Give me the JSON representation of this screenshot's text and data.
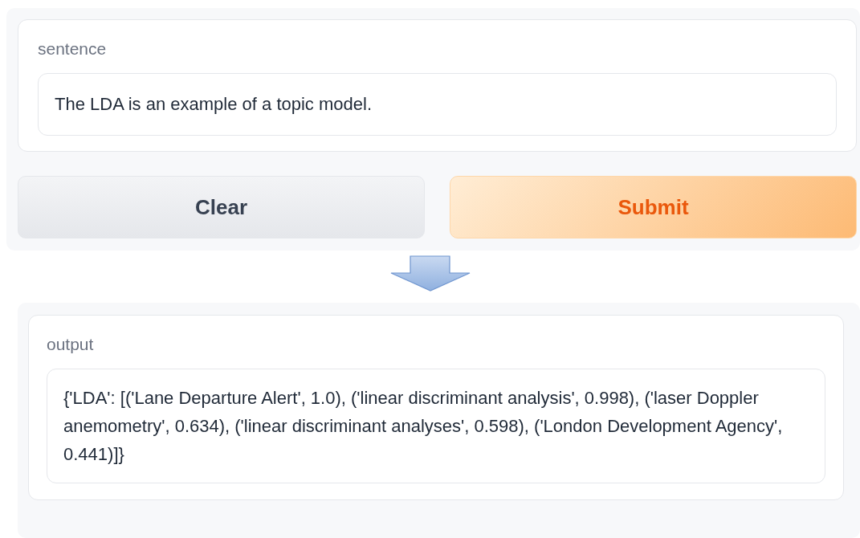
{
  "input_panel": {
    "label": "sentence",
    "value": "The LDA is an example of a topic model."
  },
  "buttons": [
    {
      "label": "Clear",
      "kind": "secondary"
    },
    {
      "label": "Submit",
      "kind": "primary"
    }
  ],
  "output_panel": {
    "label": "output",
    "value": "{'LDA': [('Lane Departure Alert', 1.0), ('linear discriminant analysis', 0.998), ('laser Doppler anemometry', 0.634), ('linear discriminant analyses', 0.598), ('London Development Agency', 0.441)]}"
  }
}
